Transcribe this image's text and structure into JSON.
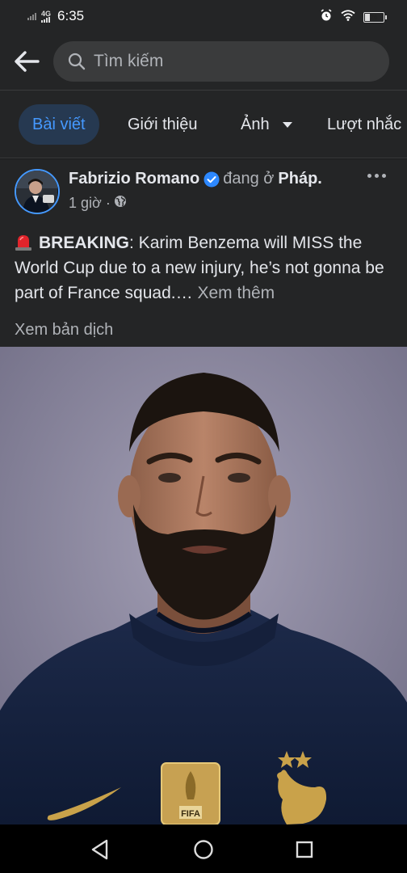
{
  "status_bar": {
    "network": "4G",
    "time": "6:35",
    "battery_level": "26",
    "icons": [
      "signal-icon",
      "alarm-icon",
      "wifi-icon",
      "battery-icon"
    ]
  },
  "search": {
    "placeholder": "Tìm kiếm"
  },
  "tabs": [
    {
      "label": "Bài viết",
      "active": true
    },
    {
      "label": "Giới thiệu",
      "active": false
    },
    {
      "label": "Ảnh",
      "active": false
    },
    {
      "label": "Lượt nhắc",
      "active": false
    }
  ],
  "post": {
    "author": "Fabrizio Romano",
    "location_prefix": "đang ở",
    "location": "Pháp.",
    "time": "1 giờ ·",
    "privacy_icon": "globe-icon",
    "text_strong": "BREAKING",
    "text_body": ": Karim Benzema will MISS the World Cup due to a new injury, he’s not gonna be part of France squad.…",
    "see_more": "Xem thêm",
    "translate": "Xem bản dịch",
    "jersey_badge_text": "FIFA"
  },
  "colors": {
    "background": "#242526",
    "accent": "#4599ff",
    "active_tab_bg": "#263951",
    "secondary_text": "#b0b3b8"
  }
}
